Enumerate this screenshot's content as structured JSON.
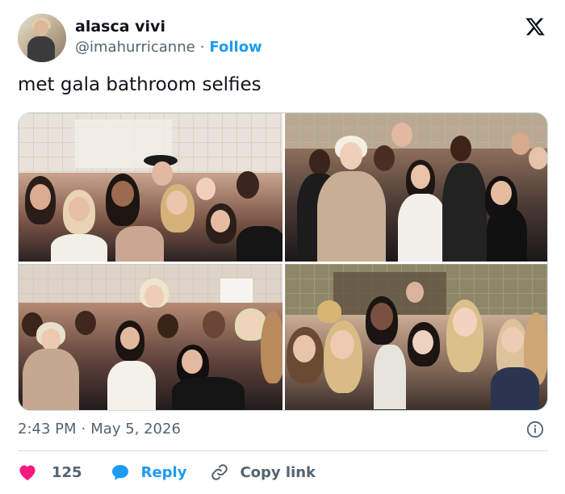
{
  "author": {
    "name": "alasca vivi",
    "handle": "@imahurricanne",
    "separator": "·",
    "follow_label": "Follow"
  },
  "tweet": {
    "text": "met gala bathroom selfies"
  },
  "media": {
    "photos": [
      {
        "name": "photo-1"
      },
      {
        "name": "photo-2"
      },
      {
        "name": "photo-3"
      },
      {
        "name": "photo-4"
      }
    ]
  },
  "meta": {
    "time": "2:43 PM",
    "separator": "·",
    "date": "May 5, 2026"
  },
  "actions": {
    "like_count": "125",
    "reply_label": "Reply",
    "copy_label": "Copy link"
  },
  "colors": {
    "accent": "#1d9bf0",
    "like": "#f91880",
    "secondary_text": "#536471",
    "primary_text": "#0f1419",
    "border": "#cfd9de"
  },
  "icons": {
    "logo": "x-logo-icon",
    "info": "info-icon",
    "like": "heart-icon",
    "reply": "speech-bubble-icon",
    "copy": "link-icon"
  }
}
